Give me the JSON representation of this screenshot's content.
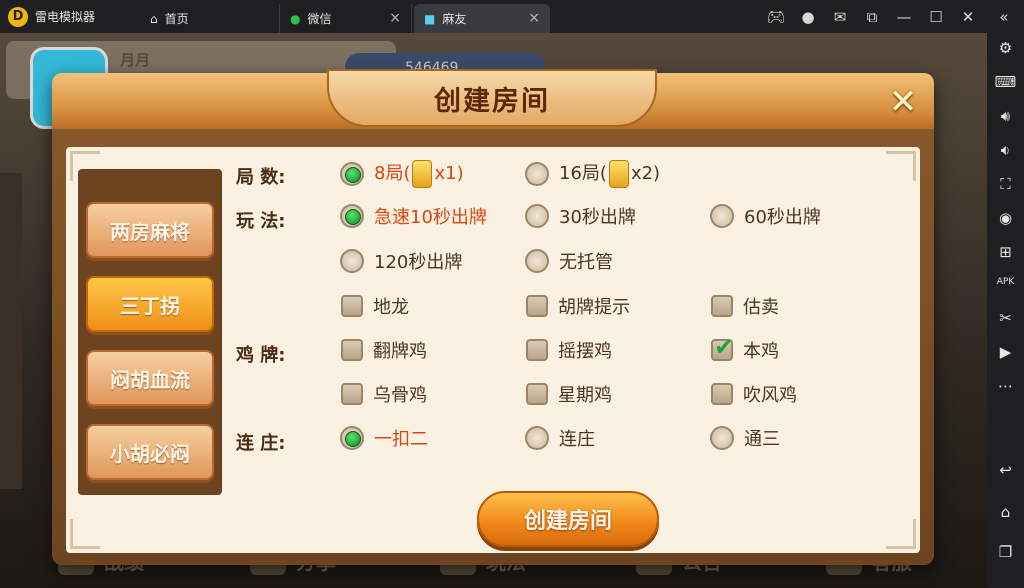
{
  "emulator": {
    "app_name": "雷电模拟器",
    "tabs": [
      {
        "label": "首页",
        "icon": "home-icon"
      },
      {
        "label": "微信",
        "icon": "wechat-icon"
      },
      {
        "label": "麻友",
        "icon": "game-app-icon",
        "active": true
      }
    ],
    "window_controls": [
      "gamepad-icon",
      "account-icon",
      "mail-icon",
      "popout-icon",
      "minimize-icon",
      "maximize-icon",
      "close-icon"
    ],
    "sidebar_icons": [
      "settings-icon",
      "keyboard-icon",
      "volume-up-icon",
      "volume-down-icon",
      "fullscreen-icon",
      "record-icon",
      "add-app-icon",
      "apk-icon",
      "scissors-icon",
      "video-icon",
      "more-icon",
      "back-icon",
      "home-icon",
      "recent-apps-icon"
    ],
    "sidebar_apk_text": "APK"
  },
  "background": {
    "player_name": "月月",
    "coins": "546469",
    "bottom_bar": [
      {
        "label": "战绩",
        "icon": "trophy-icon"
      },
      {
        "label": "分享",
        "icon": "share-icon"
      },
      {
        "label": "玩法",
        "icon": "rules-icon"
      },
      {
        "label": "公告",
        "icon": "mail-icon"
      },
      {
        "label": "客服",
        "icon": "headset-icon"
      }
    ]
  },
  "dialog": {
    "title": "创建房间",
    "modes": [
      {
        "label": "两房麻将",
        "active": false
      },
      {
        "label": "三丁拐",
        "active": true
      },
      {
        "label": "闷胡血流",
        "active": false
      },
      {
        "label": "小胡必闷",
        "active": false
      }
    ],
    "sections": {
      "rounds": {
        "label": "局  数:",
        "options": [
          {
            "text": "8局(",
            "card_mult": "x1)",
            "selected": true
          },
          {
            "text": "16局(",
            "card_mult": "x2)",
            "selected": false
          }
        ]
      },
      "play": {
        "label": "玩  法:",
        "radios": [
          {
            "text": "急速10秒出牌",
            "selected": true
          },
          {
            "text": "30秒出牌",
            "selected": false
          },
          {
            "text": "60秒出牌",
            "selected": false
          },
          {
            "text": "120秒出牌",
            "selected": false
          },
          {
            "text": "无托管",
            "selected": false
          }
        ],
        "checks": [
          {
            "text": "地龙",
            "checked": false
          },
          {
            "text": "胡牌提示",
            "checked": false
          },
          {
            "text": "估卖",
            "checked": false
          }
        ]
      },
      "chicken": {
        "label": "鸡  牌:",
        "checks": [
          {
            "text": "翻牌鸡",
            "checked": false
          },
          {
            "text": "摇摆鸡",
            "checked": false
          },
          {
            "text": "本鸡",
            "checked": true
          },
          {
            "text": "乌骨鸡",
            "checked": false
          },
          {
            "text": "星期鸡",
            "checked": false
          },
          {
            "text": "吹风鸡",
            "checked": false
          }
        ]
      },
      "dealer": {
        "label": "连  庄:",
        "options": [
          {
            "text": "一扣二",
            "selected": true
          },
          {
            "text": "连庄",
            "selected": false
          },
          {
            "text": "通三",
            "selected": false
          }
        ]
      }
    },
    "create_button": "创建房间"
  }
}
